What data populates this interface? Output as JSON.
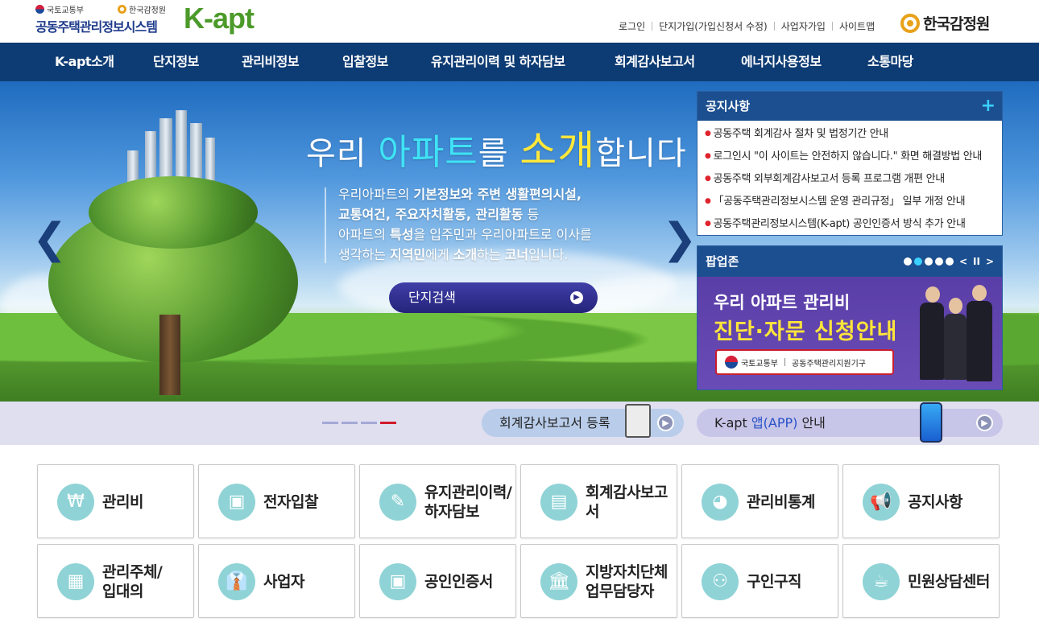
{
  "header": {
    "ministry": "국토교통부",
    "agency_small": "한국감정원",
    "system_name": "공동주택관리정보시스템",
    "brand": "K-apt",
    "util_links": [
      "로그인",
      "단지가입(가입신청서 수정)",
      "사업자가입",
      "사이트맵"
    ],
    "agency_logo": "한국감정원"
  },
  "nav": [
    "K-apt소개",
    "단지정보",
    "관리비정보",
    "입찰정보",
    "유지관리이력 및 하자담보",
    "회계감사보고서",
    "에너지사용정보",
    "소통마당"
  ],
  "hero": {
    "title_parts": [
      "우리 ",
      "아",
      "파트",
      "를 ",
      "소",
      "개",
      "합니다"
    ],
    "desc": {
      "l1a": "우리아파트의 ",
      "l1b": "기본정보와 주변 생활편의시설,",
      "l2": "교통여건, 주요자치활동, 관리활동",
      "l2b": " 등",
      "l3a": "아파트의 ",
      "l3b": "특성",
      "l3c": "을 입주민과 우리아파트로 이사를",
      "l4a": "생각하는 ",
      "l4b": "지역민",
      "l4c": "에게 ",
      "l4d": "소개",
      "l4e": "하는 ",
      "l4f": "코너",
      "l4g": "입니다."
    },
    "button": "단지검색",
    "prev_icon": "chevron-left-icon",
    "next_icon": "chevron-right-icon"
  },
  "notice": {
    "title": "공지사항",
    "more": "+",
    "items": [
      "공동주택 회계감사 절차 및 법정기간 안내",
      "로그인시 \"이 사이트는 안전하지 않습니다.\" 화면 해결방법 안내",
      "공동주택 외부회계감사보고서 등록 프로그램 개편 안내",
      "「공동주택관리정보시스템 운영 관리규정」 일부 개정 안내",
      "공동주택관리정보시스템(K-apt) 공인인증서 방식 추가 안내"
    ]
  },
  "popup": {
    "title": "팝업존",
    "dots": 5,
    "active_dot": 1,
    "pause": "II",
    "prev": "<",
    "next": ">",
    "line1": "우리 아파트 관리비",
    "line2": "진단·자문 신청안내",
    "badge_left": "국토교통부",
    "badge_right": "공동주택관리지원기구"
  },
  "strip": {
    "pill1": "회계감사보고서 등록",
    "pill2_a": "K-apt ",
    "pill2_b": "앱(APP)",
    "pill2_c": " 안내"
  },
  "quick": [
    {
      "label": "관리비",
      "icon": "money-bag-icon",
      "glyph": "₩"
    },
    {
      "label": "전자입찰",
      "icon": "tablet-bid-icon",
      "glyph": "▣"
    },
    {
      "label": "유지관리이력/\n하자담보",
      "icon": "wrench-icon",
      "glyph": "✎"
    },
    {
      "label": "회계감사보고서",
      "icon": "report-icon",
      "glyph": "▤"
    },
    {
      "label": "관리비통계",
      "icon": "pie-chart-icon",
      "glyph": "◕"
    },
    {
      "label": "공지사항",
      "icon": "megaphone-icon",
      "glyph": "📢"
    },
    {
      "label": "관리주체/\n입대의",
      "icon": "calculator-icon",
      "glyph": "▦"
    },
    {
      "label": "사업자",
      "icon": "businessman-icon",
      "glyph": "👔"
    },
    {
      "label": "공인인증서",
      "icon": "certificate-icon",
      "glyph": "▣"
    },
    {
      "label": "지방자치단체\n업무담당자",
      "icon": "government-building-icon",
      "glyph": "🏛"
    },
    {
      "label": "구인구직",
      "icon": "people-icon",
      "glyph": "⚇"
    },
    {
      "label": "민원상담센터",
      "icon": "coffee-cup-icon",
      "glyph": "☕"
    }
  ]
}
